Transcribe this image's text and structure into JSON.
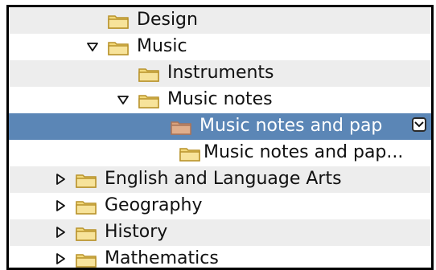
{
  "tree": {
    "rows": [
      {
        "label": "Design",
        "expander": "none",
        "icon": "folder-icon",
        "highlight": "alt"
      },
      {
        "label": "Music",
        "expander": "expanded",
        "icon": "folder-icon",
        "highlight": "none"
      },
      {
        "label": "Instruments",
        "expander": "none",
        "icon": "folder-icon",
        "highlight": "alt"
      },
      {
        "label": "Music notes",
        "expander": "expanded",
        "icon": "folder-icon",
        "highlight": "none"
      },
      {
        "label": "Music notes and pap",
        "expander": "none",
        "icon": "folder-icon",
        "highlight": "selected",
        "control_icon": "chevron-down-icon"
      },
      {
        "label": "Music notes and pap...",
        "expander": "none",
        "icon": "folder-icon",
        "highlight": "none"
      },
      {
        "label": "English and Language Arts",
        "expander": "collapsed",
        "icon": "folder-icon",
        "highlight": "alt"
      },
      {
        "label": "Geography",
        "expander": "collapsed",
        "icon": "folder-icon",
        "highlight": "none"
      },
      {
        "label": "History",
        "expander": "collapsed",
        "icon": "folder-icon",
        "highlight": "alt"
      },
      {
        "label": "Mathematics",
        "expander": "collapsed",
        "icon": "folder-icon",
        "highlight": "none"
      }
    ]
  },
  "colors": {
    "selection": "#5b86b6",
    "alt_row": "#ededed",
    "folder_fill": "#f3d97a",
    "folder_stroke": "#b8922a",
    "folder_selected": "#d9a07a"
  }
}
